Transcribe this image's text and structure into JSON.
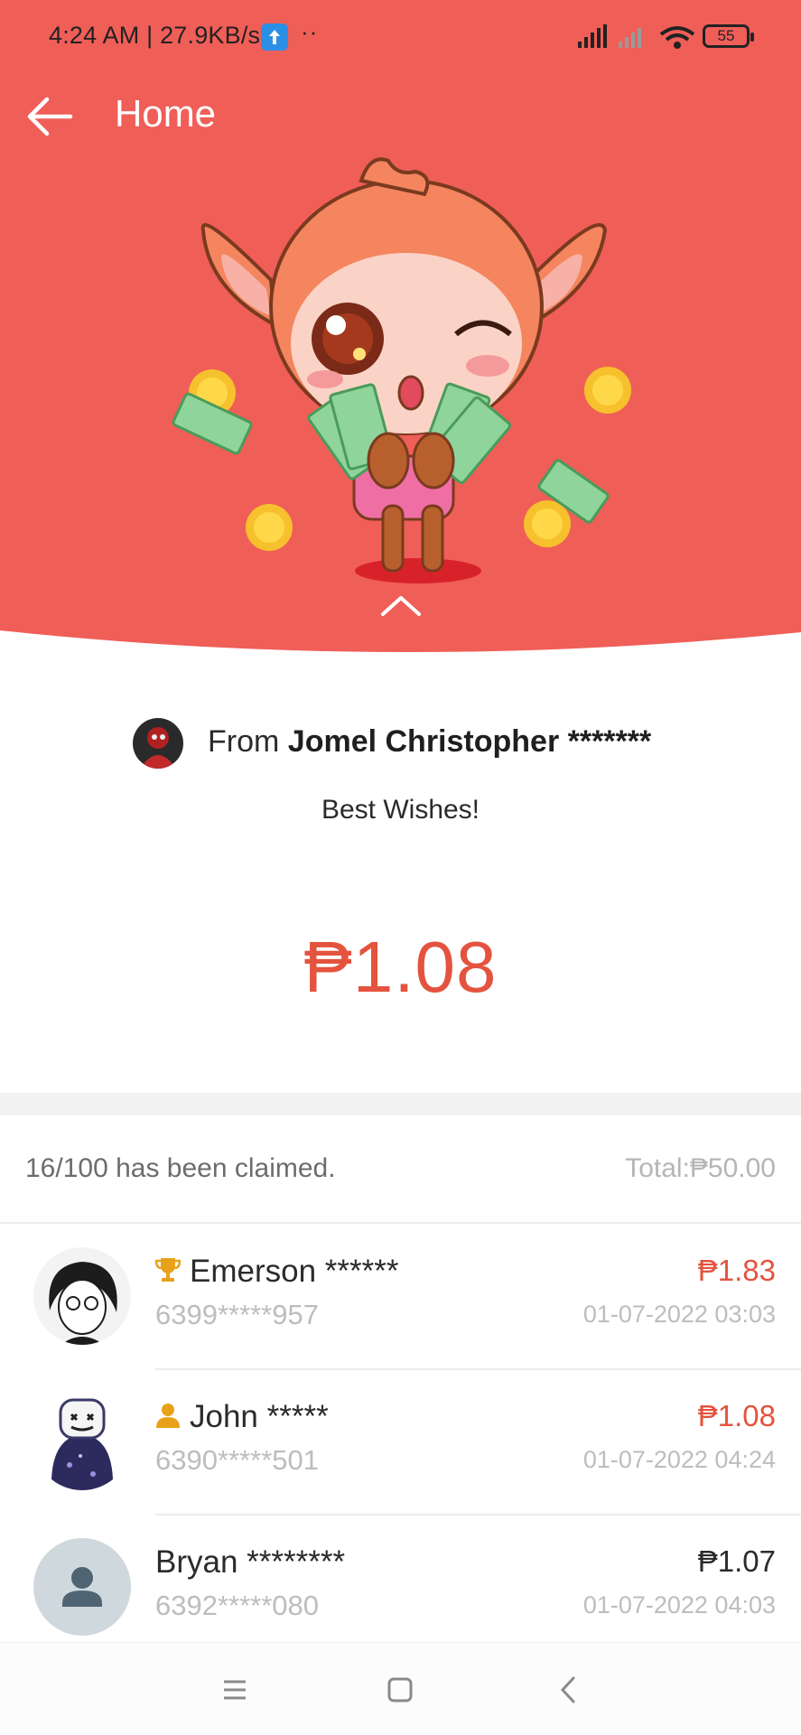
{
  "status_bar": {
    "time": "4:24 AM | 27.9KB/s",
    "dots": "··",
    "battery": "55"
  },
  "app_bar": {
    "title": "Home"
  },
  "colors": {
    "header_red": "#f05e58",
    "amount_red": "#e4533f"
  },
  "sender": {
    "prefix": "From ",
    "name": "Jomel Christopher *******",
    "message": "Best Wishes!"
  },
  "received_amount": "₱1.08",
  "summary": {
    "claimed": "16/100 has been claimed.",
    "total": "Total:₱50.00"
  },
  "claims": [
    {
      "name": "Emerson ******",
      "phone": "6399*****957",
      "amount": "₱1.83",
      "date": "01-07-2022 03:03",
      "badge": "trophy-icon"
    },
    {
      "name": "John *****",
      "phone": "6390*****501",
      "amount": "₱1.08",
      "date": "01-07-2022 04:24",
      "badge": "person-icon"
    },
    {
      "name": "Bryan ********",
      "phone": "6392*****080",
      "amount": "₱1.07",
      "date": "01-07-2022 04:03",
      "badge": ""
    }
  ]
}
